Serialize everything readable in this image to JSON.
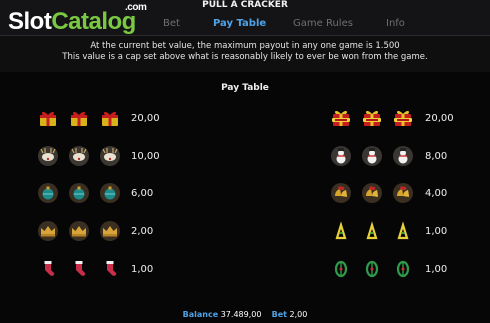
{
  "logo": {
    "part1": "Slot",
    "part2": "Catalog",
    "suffix": ".com"
  },
  "game_title": "PULL A CRACKER",
  "nav": {
    "tabs": [
      {
        "label": "Bet",
        "active": false
      },
      {
        "label": "Pay Table",
        "active": true
      },
      {
        "label": "Game Rules",
        "active": false
      },
      {
        "label": "Info",
        "active": false
      }
    ]
  },
  "notice": {
    "line1": "At the current bet value, the maximum payout in any one game is 1.500",
    "line2": "This value is a cap set above what is reasonably likely to ever be won from the game."
  },
  "pay_table": {
    "title": "Pay Table",
    "left": [
      {
        "symbol": "gift-icon",
        "payout": "20,00"
      },
      {
        "symbol": "reindeer-icon",
        "payout": "10,00"
      },
      {
        "symbol": "ornament-icon",
        "payout": "6,00"
      },
      {
        "symbol": "crown-icon",
        "payout": "2,00"
      },
      {
        "symbol": "stocking-icon",
        "payout": "1,00"
      }
    ],
    "right": [
      {
        "symbol": "wild-gift-icon",
        "payout": "20,00"
      },
      {
        "symbol": "snowman-icon",
        "payout": "8,00"
      },
      {
        "symbol": "bells-icon",
        "payout": "4,00"
      },
      {
        "symbol": "candy-icon",
        "payout": "1,00"
      },
      {
        "symbol": "holly-icon",
        "payout": "1,00"
      }
    ]
  },
  "footer": {
    "balance_label": "Balance",
    "balance_value": "37.489,00",
    "bet_label": "Bet",
    "bet_value": "2,00"
  },
  "colors": {
    "accent": "#4fa3e6",
    "logo_green": "#7bc943",
    "background": "#0f0f10"
  }
}
